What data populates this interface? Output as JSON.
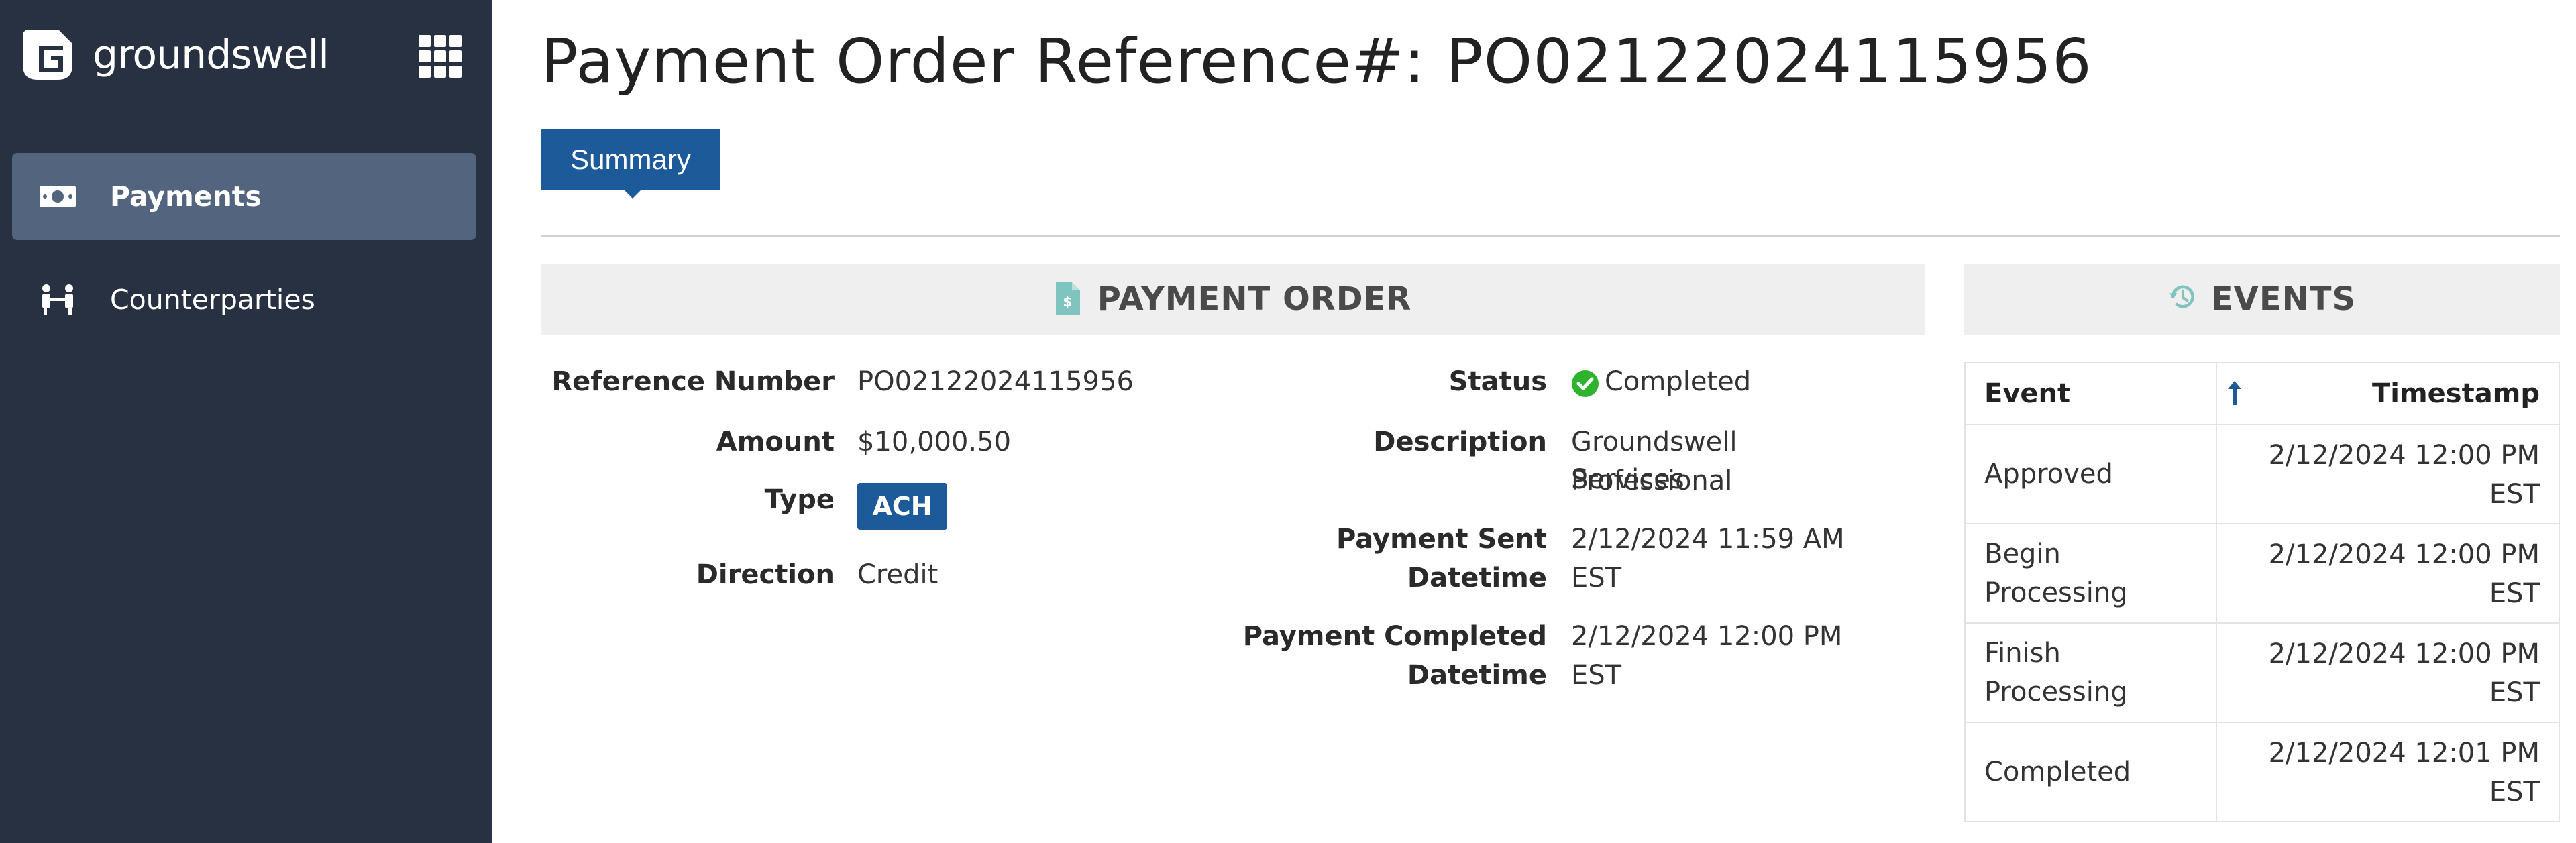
{
  "brand": {
    "name": "groundswell",
    "logo_icon": "groundswell-logo-icon",
    "apps_icon": "apps-grid-icon"
  },
  "sidebar": {
    "items": [
      {
        "label": "Payments",
        "icon": "payments-icon",
        "active": true
      },
      {
        "label": "Counterparties",
        "icon": "counterparties-icon",
        "active": false
      }
    ]
  },
  "page": {
    "title": "Payment Order Reference#: PO02122024115956"
  },
  "tabs": [
    {
      "label": "Summary",
      "active": true
    }
  ],
  "payment_order": {
    "header": "PAYMENT ORDER",
    "header_icon": "document-icon",
    "left_fields": [
      {
        "label": "Reference Number",
        "value": "PO02122024115956"
      },
      {
        "label": "Amount",
        "value": "$10,000.50"
      },
      {
        "label": "Type",
        "value": "ACH"
      },
      {
        "label": "Direction",
        "value": "Credit"
      }
    ],
    "status": {
      "label": "Status",
      "value": "Completed",
      "icon": "check-circle-icon",
      "color": "#2fb32f"
    },
    "description": {
      "label": "Description",
      "line1": "Groundswell Professional",
      "line2": "Services"
    },
    "sent": {
      "label_line1": "Payment Sent",
      "label_line2": "Datetime",
      "value": "2/12/2024 11:59 AM EST"
    },
    "completed": {
      "label_line1": "Payment Completed",
      "label_line2": "Datetime",
      "value": "2/12/2024 12:00 PM EST"
    }
  },
  "events": {
    "header": "EVENTS",
    "header_icon": "history-icon",
    "columns": {
      "event": "Event",
      "timestamp": "Timestamp",
      "sort_icon": "sort-arrow-up-icon"
    },
    "rows": [
      {
        "event_line1": "Approved",
        "event_line2": "",
        "ts_line1": "2/12/2024 12:00 PM",
        "ts_line2": "EST"
      },
      {
        "event_line1": "Begin",
        "event_line2": "Processing",
        "ts_line1": "2/12/2024 12:00 PM",
        "ts_line2": "EST"
      },
      {
        "event_line1": "Finish",
        "event_line2": "Processing",
        "ts_line1": "2/12/2024 12:00 PM",
        "ts_line2": "EST"
      },
      {
        "event_line1": "Completed",
        "event_line2": "",
        "ts_line1": "2/12/2024 12:01 PM",
        "ts_line2": "EST"
      }
    ]
  },
  "colors": {
    "sidebar_bg": "#283141",
    "active_item": "#53647f",
    "accent": "#1d5a9a",
    "panel_header_bg": "#efefef",
    "icon_teal": "#7fc4be"
  }
}
